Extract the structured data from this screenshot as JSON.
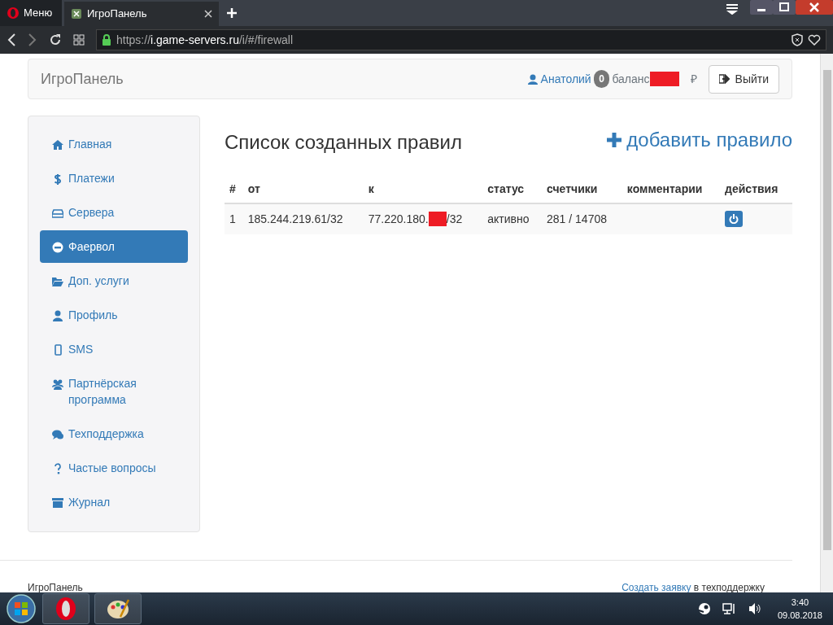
{
  "browser": {
    "menu_label": "Меню",
    "tabs": [
      {
        "label": "ИгроПанель",
        "selected": true
      }
    ],
    "url": {
      "scheme": "https://",
      "host": "i.game-servers.ru",
      "path": "/i/#/firewall"
    }
  },
  "header": {
    "brand": "ИгроПанель",
    "user": "Анатолий",
    "badge": "0",
    "balance_label": "баланс",
    "currency": "₽",
    "logout": "Выйти"
  },
  "sidebar": {
    "items": [
      {
        "label": "Главная",
        "selected": false
      },
      {
        "label": "Платежи",
        "selected": false
      },
      {
        "label": "Сервера",
        "selected": false
      },
      {
        "label": "Фаервол",
        "selected": true
      },
      {
        "label": "Доп. услуги",
        "selected": false
      },
      {
        "label": "Профиль",
        "selected": false
      },
      {
        "label": "SMS",
        "selected": false
      },
      {
        "label": "Партнёрская программа",
        "selected": false
      },
      {
        "label": "Техподдержка",
        "selected": false
      },
      {
        "label": "Частые вопросы",
        "selected": false
      },
      {
        "label": "Журнал",
        "selected": false
      }
    ]
  },
  "main": {
    "title": "Список созданных правил",
    "add_label": "добавить правило",
    "table": {
      "columns": [
        "#",
        "от",
        "к",
        "статус",
        "счетчики",
        "комментарии",
        "действия"
      ],
      "rows": [
        {
          "num": "1",
          "from": "185.244.219.61/32",
          "to_prefix": "77.220.180.",
          "to_suffix": "/32",
          "status": "активно",
          "counters": "281 / 14708"
        }
      ]
    }
  },
  "footer": {
    "brand": "ИгроПанель",
    "link": "Создать заявку",
    "link_rest": "в техподдержку"
  },
  "taskbar": {
    "time": "3:40",
    "date": "09.08.2018"
  }
}
